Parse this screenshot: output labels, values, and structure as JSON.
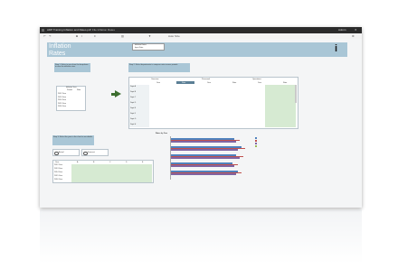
{
  "app": {
    "window_title": "ADP Training Inflation and Rates.pdf",
    "tab_label": "File Inflation Rates",
    "user_label": "Admin"
  },
  "toolbar": {
    "zoom_label": "Auto Size"
  },
  "sheet": {
    "title_line1": "Inflation",
    "title_line2": "Rates",
    "info_icon": "info-icon",
    "legend_top": [
      "Inflation Rates",
      "Input Data"
    ],
    "step1": "Step 1: Select a year from the drop-down to view the inflation rates.",
    "step2": "Step 2: Select departments to compare rates across periods.",
    "step3": "Step 3: Select the year in the chart to see details.",
    "filter_box_label": "Inflation Year",
    "filter_col_headers": [
      "Period",
      "Rate"
    ],
    "filter_rows": [
      "2012 Year",
      "2013 Year",
      "2014 Year",
      "2015 Year",
      "2016 Year"
    ],
    "chart_title": "Rates by Year",
    "options": [
      "Actual",
      "Forecast"
    ]
  },
  "matrix": {
    "groups": [
      "Overview",
      "Personnel",
      "Operations"
    ],
    "col_headers": [
      "Year",
      "Rate",
      "Year",
      "Rate",
      "Year",
      "Rate"
    ],
    "row_labels": [
      "Dept A",
      "Dept B",
      "Dept C",
      "Dept D",
      "Dept E",
      "Dept F",
      "Dept G",
      "Dept H"
    ]
  },
  "bottom_table": {
    "col_headers": [
      "Year",
      "A",
      "B",
      "C",
      "D",
      "E"
    ],
    "row_labels": [
      "2012 Year",
      "2013 Year",
      "2014 Year",
      "2015 Year",
      "2016 Year"
    ]
  },
  "colors": {
    "accent": "#a9c6d6",
    "series_blue": "#4f81bd",
    "series_red": "#c0504d",
    "series_purple": "#8064a2",
    "series_green": "#9bbb59",
    "arrow_green": "#3c6e2f"
  }
}
